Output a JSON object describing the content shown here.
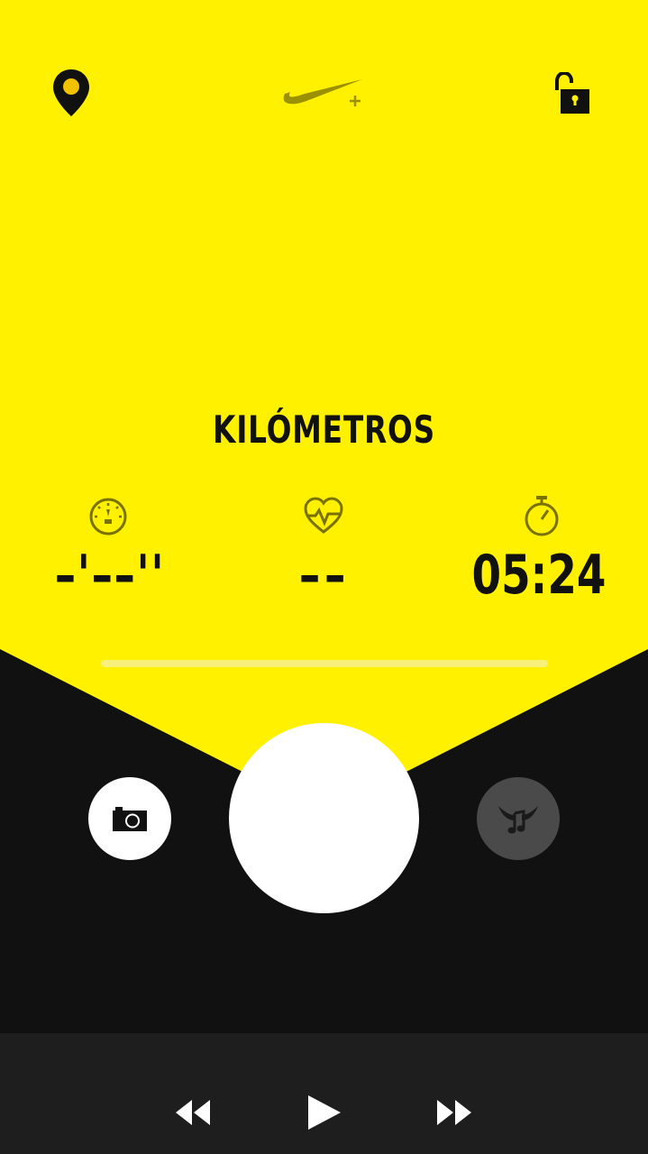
{
  "header": {
    "location_icon": "location-pin-icon",
    "logo_icon": "nike-plus-swoosh-logo",
    "lock_icon": "unlocked-padlock-icon"
  },
  "main": {
    "title": "KILÓMETROS",
    "stats": {
      "pace": {
        "icon": "speedometer-icon",
        "value": "–'––''"
      },
      "heart_rate": {
        "icon": "heart-rate-icon",
        "value": "––"
      },
      "duration": {
        "icon": "stopwatch-icon",
        "value": "05:24"
      }
    },
    "progress": 0
  },
  "controls": {
    "camera_icon": "camera-icon",
    "powersong_icon": "winged-music-note-icon"
  },
  "music": {
    "rewind_icon": "rewind-icon",
    "play_icon": "play-icon",
    "forward_icon": "fast-forward-icon"
  },
  "colors": {
    "yellow": "#fff100",
    "dark": "#111111",
    "music_bar": "#1e1e1e",
    "powersong_button": "#4a4a4a",
    "white": "#ffffff"
  }
}
